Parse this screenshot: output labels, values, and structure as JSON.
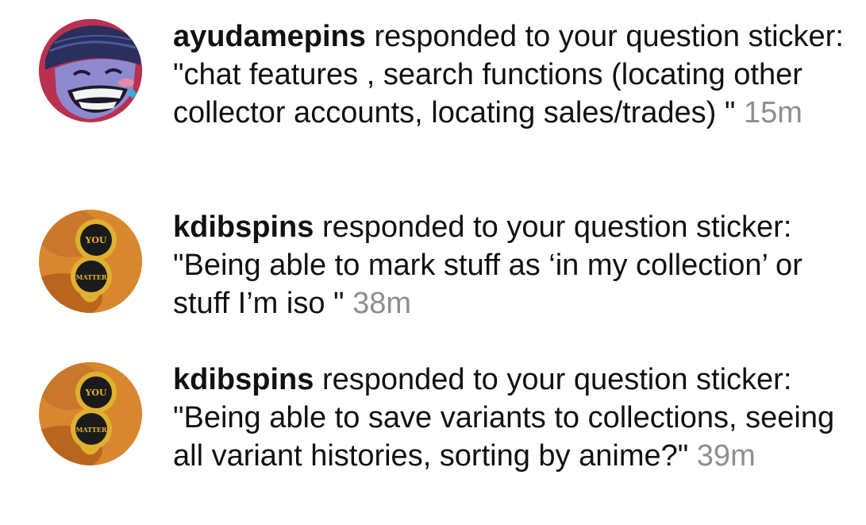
{
  "notifications": [
    {
      "username": "ayudamepins",
      "action": "responded to your question sticker:",
      "response": "\"chat features , search functions (locating other collector accounts, locating sales/trades) \"",
      "time": "15m",
      "avatar_icon": "cartoon-character-avatar"
    },
    {
      "username": "kdibspins",
      "action": "responded to your question sticker:",
      "response": "\"Being able to mark stuff as ‘in my collection’ or stuff I’m iso \"",
      "time": "38m",
      "avatar_icon": "you-matter-pin-avatar"
    },
    {
      "username": "kdibspins",
      "action": "responded to your question sticker:",
      "response": "\"Being able to save variants to collections, seeing all variant histories, sorting by anime?\"",
      "time": "39m",
      "avatar_icon": "you-matter-pin-avatar"
    }
  ],
  "avatar_pin_text": {
    "top": "YOU",
    "bottom": "MATTER"
  },
  "colors": {
    "text": "#111111",
    "timestamp": "#8e8e8e"
  }
}
